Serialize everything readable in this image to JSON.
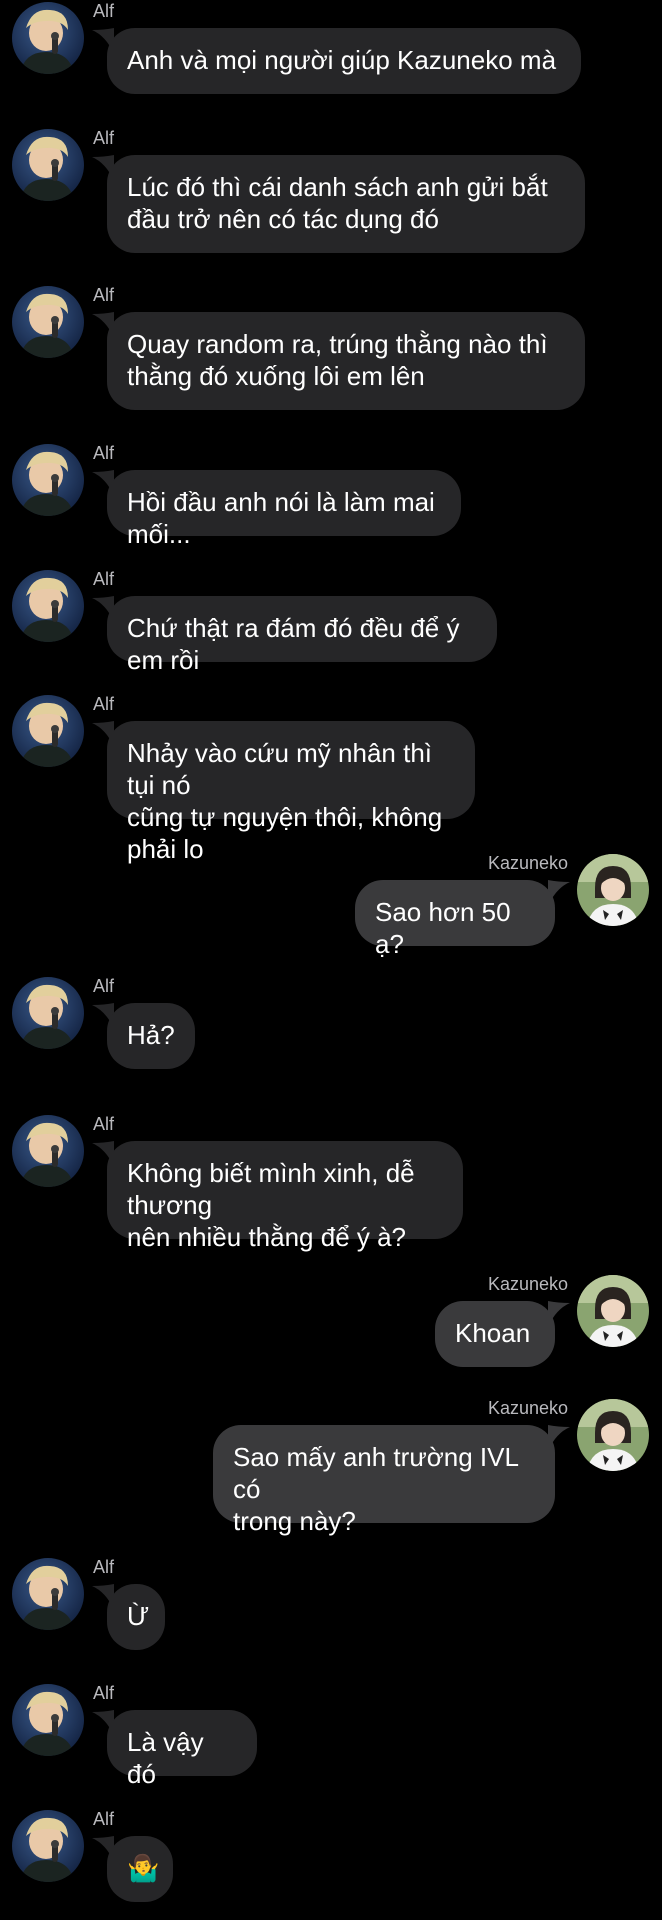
{
  "colors": {
    "background": "#000000",
    "incoming_bubble": "#262628",
    "outgoing_bubble": "#3a3a3c",
    "text": "#ffffff",
    "sender_name": "#b9b9bd"
  },
  "messages": [
    {
      "side": "left",
      "sender": "Alf",
      "text": "Anh và mọi người giúp Kazuneko mà",
      "avatar_icon": "alf-avatar"
    },
    {
      "side": "left",
      "sender": "Alf",
      "text": "Lúc đó thì cái danh sách anh gửi bắt\nđầu trở nên có tác dụng đó",
      "avatar_icon": "alf-avatar"
    },
    {
      "side": "left",
      "sender": "Alf",
      "text": "Quay random ra, trúng thằng nào thì\nthằng đó xuống lôi em lên",
      "avatar_icon": "alf-avatar"
    },
    {
      "side": "left",
      "sender": "Alf",
      "text": "Hồi đầu anh nói là làm mai mối...",
      "avatar_icon": "alf-avatar"
    },
    {
      "side": "left",
      "sender": "Alf",
      "text": "Chứ thật ra đám đó đều để ý em rồi",
      "avatar_icon": "alf-avatar"
    },
    {
      "side": "left",
      "sender": "Alf",
      "text": "Nhảy vào cứu mỹ nhân thì tụi nó\ncũng tự nguyện thôi, không phải lo",
      "avatar_icon": "alf-avatar"
    },
    {
      "side": "right",
      "sender": "Kazuneko",
      "text": "Sao hơn 50 ạ?",
      "avatar_icon": "kazuneko-avatar"
    },
    {
      "side": "left",
      "sender": "Alf",
      "text": "Hả?",
      "avatar_icon": "alf-avatar"
    },
    {
      "side": "left",
      "sender": "Alf",
      "text": "Không biết mình xinh, dễ thương\nnên nhiều thằng để ý à?",
      "avatar_icon": "alf-avatar"
    },
    {
      "side": "right",
      "sender": "Kazuneko",
      "text": "Khoan",
      "avatar_icon": "kazuneko-avatar"
    },
    {
      "side": "right",
      "sender": "Kazuneko",
      "text": "Sao mấy anh trường IVL có\ntrong này?",
      "avatar_icon": "kazuneko-avatar"
    },
    {
      "side": "left",
      "sender": "Alf",
      "text": "Ừ",
      "avatar_icon": "alf-avatar"
    },
    {
      "side": "left",
      "sender": "Alf",
      "text": "Là vậy đó",
      "avatar_icon": "alf-avatar"
    },
    {
      "side": "left",
      "sender": "Alf",
      "text": "🤷‍♂️",
      "avatar_icon": "shrug-emoji"
    }
  ]
}
